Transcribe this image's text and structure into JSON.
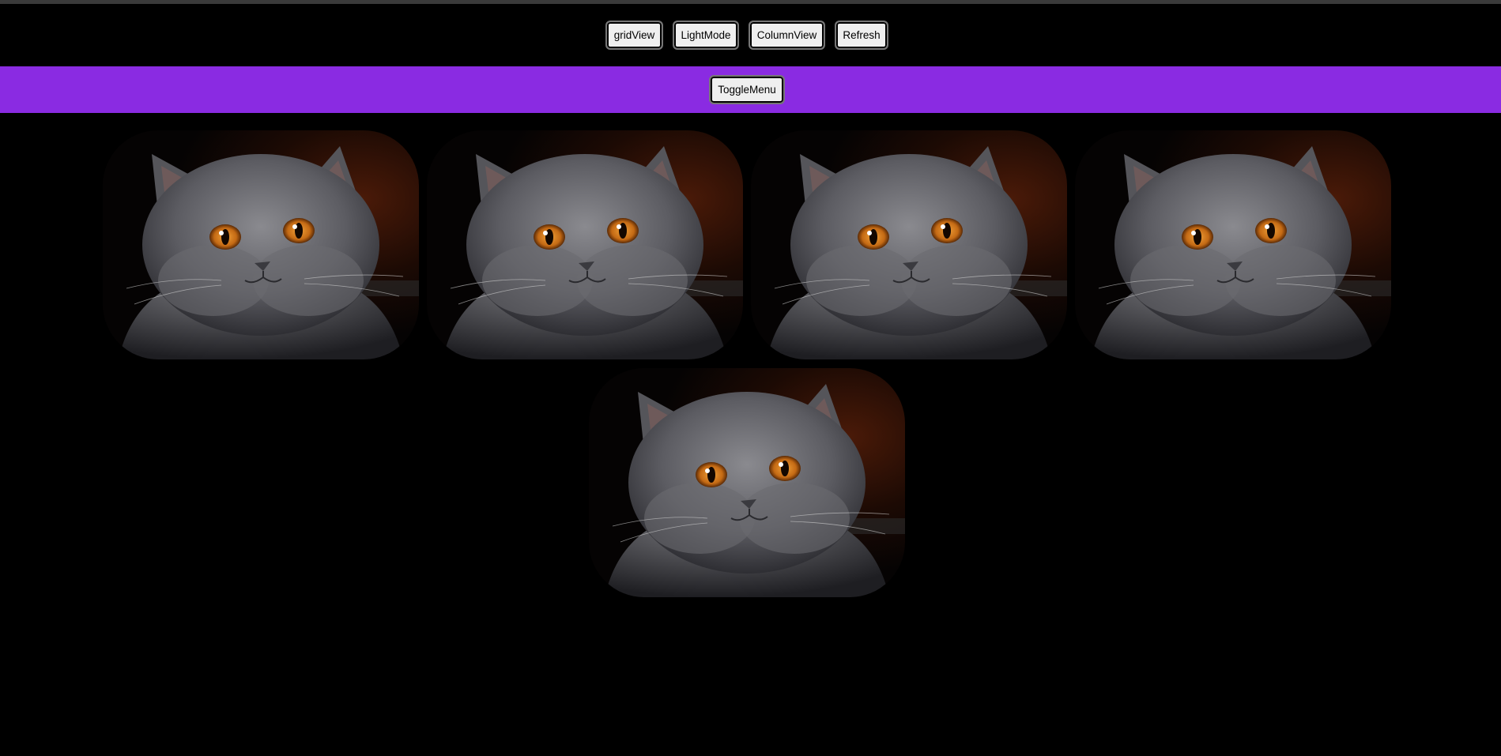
{
  "toolbar": {
    "buttons": [
      {
        "label": "gridView"
      },
      {
        "label": "LightMode"
      },
      {
        "label": "ColumnView"
      },
      {
        "label": "Refresh"
      }
    ]
  },
  "menu_bar": {
    "toggle_label": "ToggleMenu",
    "background": "#8a2be2"
  },
  "gallery": {
    "image_count": 5,
    "image_subject": "grey-cat-photo"
  }
}
